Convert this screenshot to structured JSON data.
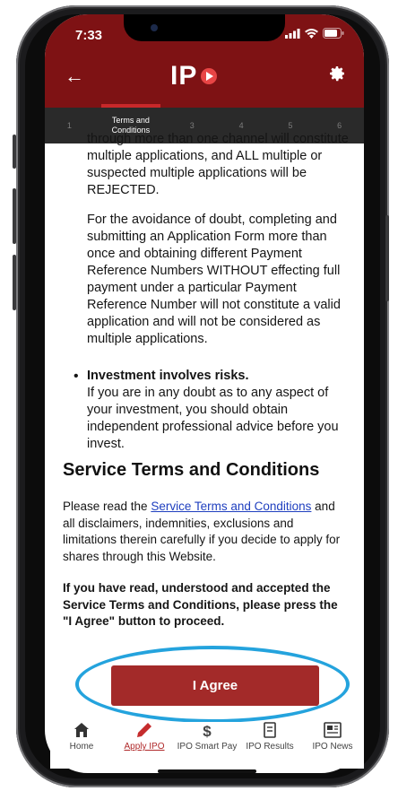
{
  "status": {
    "time": "7:33"
  },
  "header": {
    "logo_text": "IP",
    "back_icon": "back-arrow-icon",
    "settings_icon": "gear-icon",
    "brand_color": "#7e1214"
  },
  "steps": [
    {
      "number": "1",
      "label": ""
    },
    {
      "number": "",
      "label": "Terms and Conditions"
    },
    {
      "number": "3",
      "label": ""
    },
    {
      "number": "4",
      "label": ""
    },
    {
      "number": "5",
      "label": ""
    },
    {
      "number": "6",
      "label": ""
    }
  ],
  "content": {
    "intro_lines": [
      "through more than one channel will constitute",
      "multiple applications, and ALL multiple or",
      "suspected multiple applications will be",
      "REJECTED."
    ],
    "avoidance_lines": [
      "For the avoidance of doubt, completing and",
      "submitting an Application Form more than",
      "once and obtaining different Payment",
      "Reference Numbers WITHOUT effecting full",
      "payment under a particular Payment",
      "Reference Number will not constitute a valid",
      "application and will not be considered as",
      "multiple applications."
    ],
    "bullet_title": "Investment involves risks.",
    "bullet_lines": [
      "If you are in any doubt as to any aspect of",
      "your investment, you should obtain",
      "independent professional advice before you",
      "invest."
    ],
    "section_heading": "Service Terms and Conditions",
    "read_prefix": "Please read the ",
    "read_link": "Service Terms and Conditions",
    "read_suffix": " and",
    "read_lines": [
      "all disclaimers, indemnities, exclusions and",
      "limitations therein carefully if you decide to apply for",
      "shares through this Website."
    ],
    "confirm_lines": [
      "If you have read, understood and accepted the",
      "Service Terms and Conditions, please press the",
      "\"I Agree\" button to proceed."
    ]
  },
  "agree_button": {
    "label": "I Agree",
    "color": "#a32a29"
  },
  "tabs": [
    {
      "label": "Home",
      "icon": "home-icon"
    },
    {
      "label": "Apply IPO",
      "icon": "pencil-icon"
    },
    {
      "label": "IPO Smart Pay",
      "icon": "dollar-icon"
    },
    {
      "label": "IPO Results",
      "icon": "document-icon"
    },
    {
      "label": "IPO News",
      "icon": "newspaper-icon"
    }
  ],
  "highlight_color": "#24a3dd"
}
